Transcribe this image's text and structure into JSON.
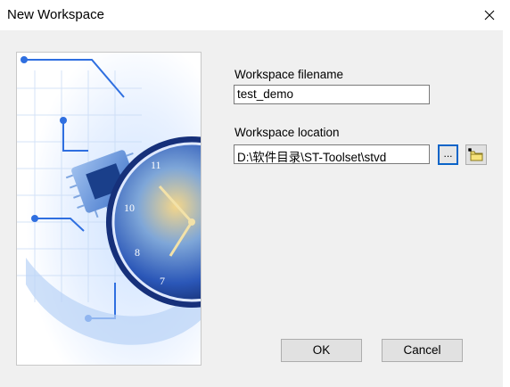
{
  "window": {
    "title": "New Workspace",
    "close_icon": "close-icon"
  },
  "form": {
    "filename_label": "Workspace filename",
    "filename_value": "test_demo",
    "location_label": "Workspace location",
    "location_value": "D:\\软件目录\\ST-Toolset\\stvd",
    "browse_label": "...",
    "new_folder_icon": "folder-icon"
  },
  "buttons": {
    "ok_label": "OK",
    "cancel_label": "Cancel"
  },
  "colors": {
    "accent": "#0a64c8",
    "art_blue": "#2f6fe0"
  }
}
